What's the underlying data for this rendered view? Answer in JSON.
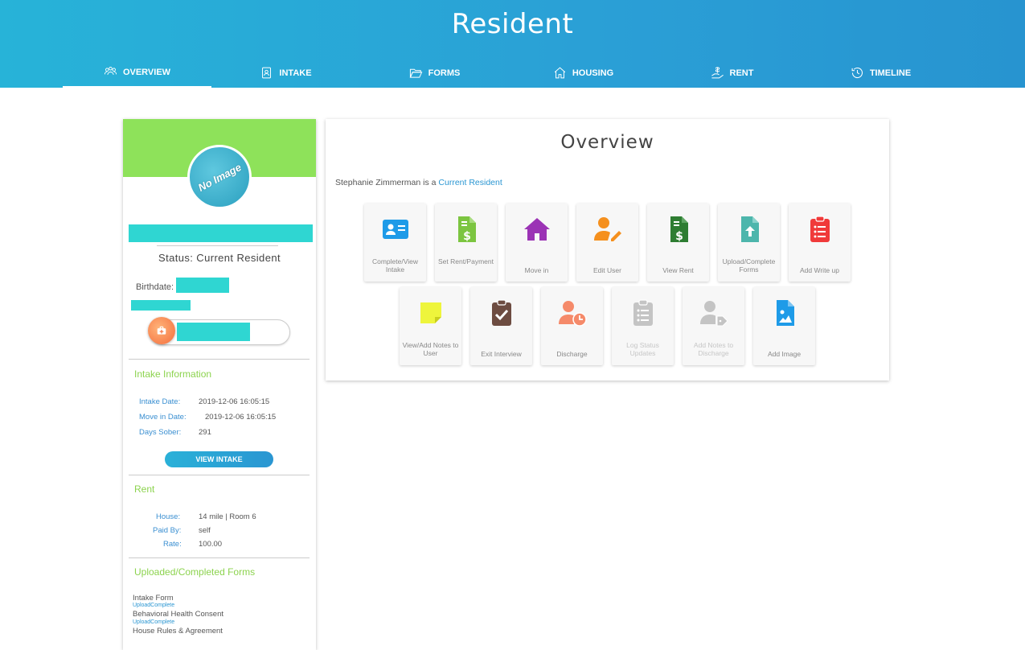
{
  "header": {
    "title": "Resident"
  },
  "tabs": [
    {
      "label": "OVERVIEW",
      "icon": "users-cog-icon",
      "active": true
    },
    {
      "label": "INTAKE",
      "icon": "id-document-icon",
      "active": false
    },
    {
      "label": "FORMS",
      "icon": "folder-open-icon",
      "active": false
    },
    {
      "label": "HOUSING",
      "icon": "home-icon",
      "active": false
    },
    {
      "label": "RENT",
      "icon": "hand-money-icon",
      "active": false
    },
    {
      "label": "TIMELINE",
      "icon": "history-icon",
      "active": false
    }
  ],
  "profile": {
    "avatar_text": "No Image",
    "status": "Status: Current Resident",
    "birthdate_label": "Birthdate:",
    "accent_color": "#8ee25a",
    "redaction_color": "#2fd6d2"
  },
  "intake": {
    "title": "Intake Information",
    "rows": [
      {
        "label": "Intake Date:",
        "value": "2019-12-06 16:05:15"
      },
      {
        "label": "Move in Date:",
        "value": "2019-12-06 16:05:15"
      },
      {
        "label": "Days Sober:",
        "value": "291"
      }
    ],
    "button": "VIEW INTAKE"
  },
  "rent": {
    "title": "Rent",
    "rows": [
      {
        "label": "House:",
        "value": "14 mile | Room 6"
      },
      {
        "label": "Paid By:",
        "value": "self"
      },
      {
        "label": "Rate:",
        "value": "100.00"
      }
    ]
  },
  "forms": {
    "title": "Uploaded/Completed Forms",
    "items": [
      {
        "name": "Intake Form",
        "status": "UploadComplete"
      },
      {
        "name": "Behavioral Health Consent",
        "status": "UploadComplete"
      },
      {
        "name": "House Rules & Agreement"
      }
    ]
  },
  "overview": {
    "title": "Overview",
    "resident_name": "Stephanie Zimmerman",
    "resident_text": " is a ",
    "resident_status": "Current Resident",
    "tiles": [
      {
        "label": "Complete/View Intake",
        "icon": "id-card-icon",
        "color": "#1e9be8",
        "enabled": true
      },
      {
        "label": "Set Rent/Payment",
        "icon": "invoice-dollar-icon",
        "color": "#7cc540",
        "enabled": true
      },
      {
        "label": "Move in",
        "icon": "house-icon",
        "color": "#9b33b5",
        "enabled": true
      },
      {
        "label": "Edit User",
        "icon": "user-edit-icon",
        "color": "#f5901e",
        "enabled": true
      },
      {
        "label": "View Rent",
        "icon": "invoice-dollar-icon",
        "color": "#2e7d32",
        "enabled": true
      },
      {
        "label": "Upload/Complete Forms",
        "icon": "file-upload-icon",
        "color": "#4db6ac",
        "enabled": true
      },
      {
        "label": "Add Write up",
        "icon": "clipboard-list-icon",
        "color": "#f03a3a",
        "enabled": true
      },
      {
        "label": "View/Add Notes to User",
        "icon": "sticky-note-icon",
        "color": "#eef53c",
        "enabled": true
      },
      {
        "label": "Exit Interview",
        "icon": "clipboard-check-icon",
        "color": "#6d4c41",
        "enabled": true
      },
      {
        "label": "Discharge",
        "icon": "user-clock-icon",
        "color": "#f58a6a",
        "enabled": true
      },
      {
        "label": "Log Status Updates",
        "icon": "clipboard-list-icon",
        "color": "#c4c4c4",
        "enabled": false
      },
      {
        "label": "Add Notes to Discharge",
        "icon": "user-tag-icon",
        "color": "#c4c4c4",
        "enabled": false
      },
      {
        "label": "Add Image",
        "icon": "file-image-icon",
        "color": "#1e9be8",
        "enabled": true
      }
    ]
  }
}
